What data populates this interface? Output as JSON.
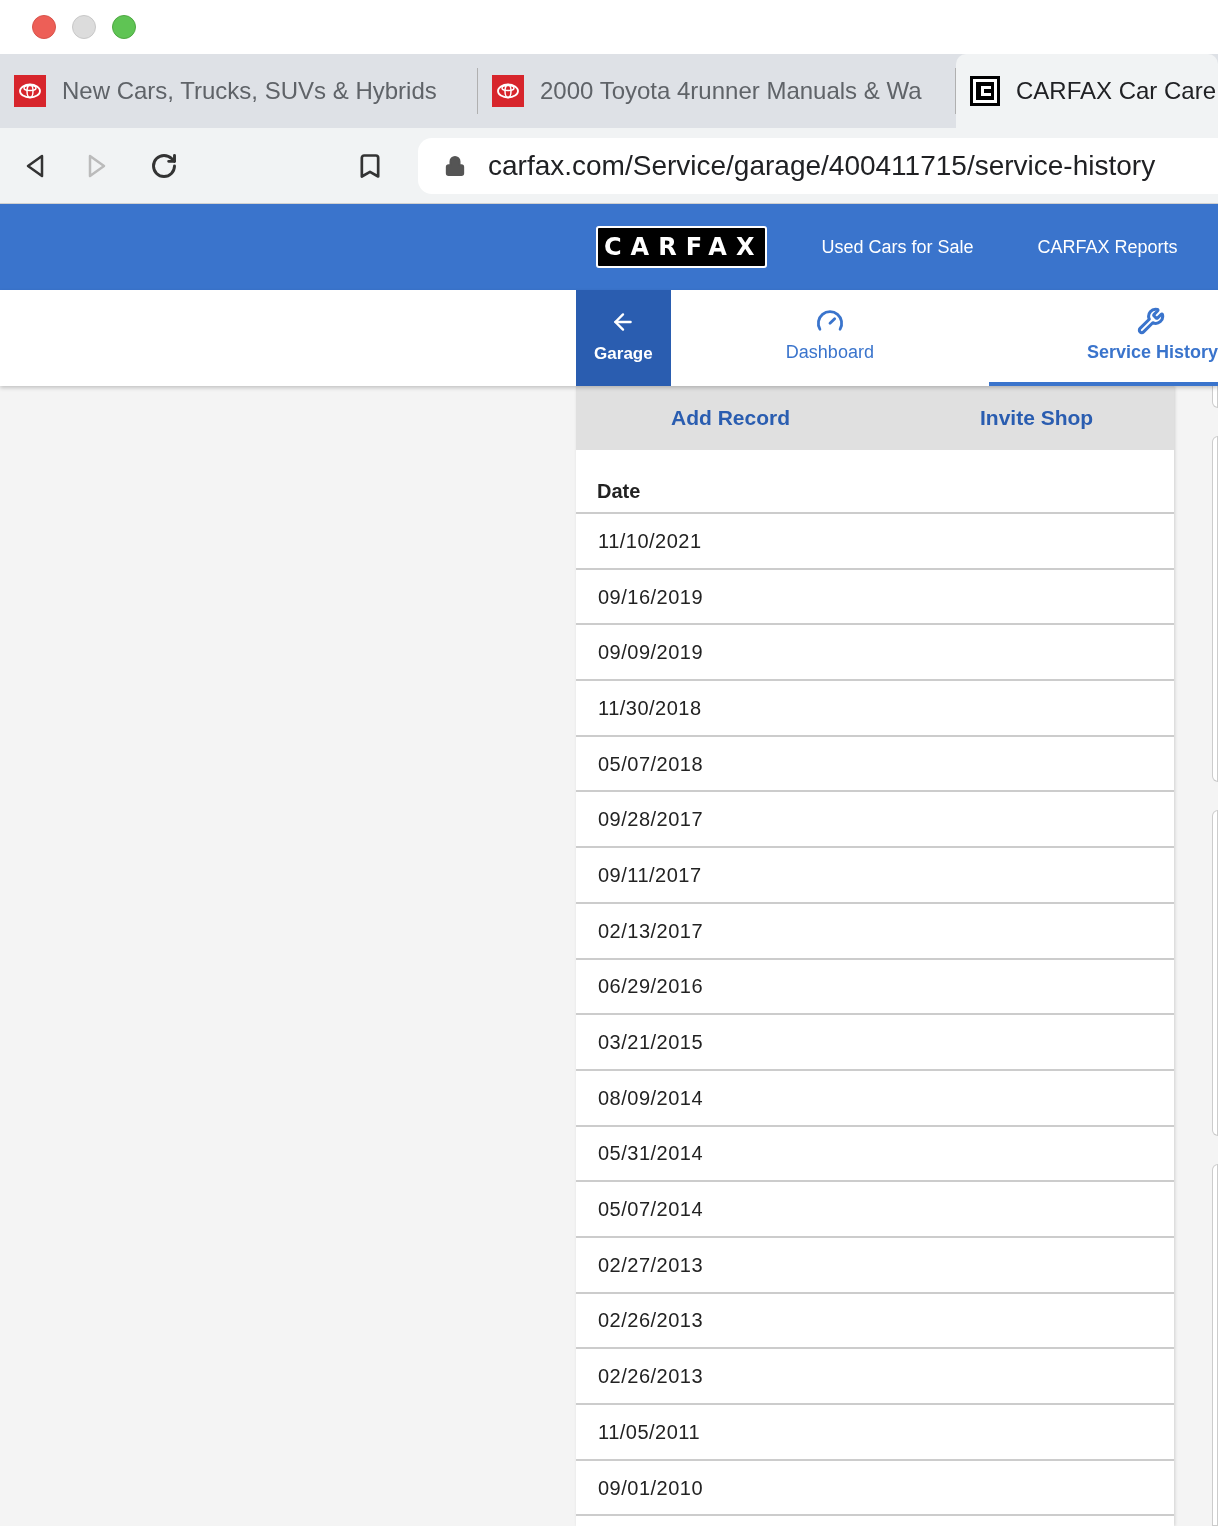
{
  "browser": {
    "tabs": [
      {
        "title": "New Cars, Trucks, SUVs & Hybrids",
        "selected": false
      },
      {
        "title": "2000 Toyota 4runner Manuals & Wa",
        "selected": false
      },
      {
        "title": "CARFAX Car Care",
        "selected": true
      }
    ],
    "url": "carfax.com/Service/garage/400411715/service-history"
  },
  "header": {
    "logo": "CARFAX",
    "links": [
      "Used Cars for Sale",
      "CARFAX Reports"
    ]
  },
  "nav": {
    "back": "Garage",
    "tabs": [
      {
        "label": "Dashboard",
        "selected": false
      },
      {
        "label": "Service History",
        "selected": true
      }
    ]
  },
  "actions": [
    "Add Record",
    "Invite Shop"
  ],
  "table": {
    "columns": [
      "Date"
    ],
    "rows": [
      "11/10/2021",
      "09/16/2019",
      "09/09/2019",
      "11/30/2018",
      "05/07/2018",
      "09/28/2017",
      "09/11/2017",
      "02/13/2017",
      "06/29/2016",
      "03/21/2015",
      "08/09/2014",
      "05/31/2014",
      "05/07/2014",
      "02/27/2013",
      "02/26/2013",
      "02/26/2013",
      "11/05/2011",
      "09/01/2010"
    ]
  }
}
